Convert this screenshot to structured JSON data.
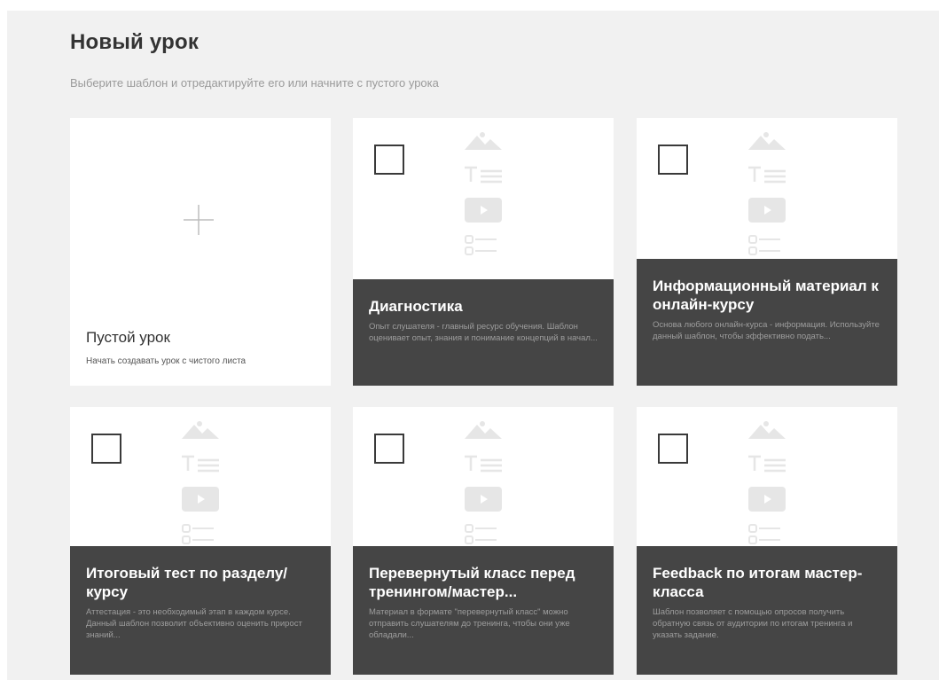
{
  "header": {
    "title": "Новый урок",
    "subtitle": "Выберите шаблон и отредактируйте его или начните с пустого урока"
  },
  "empty_card": {
    "title": "Пустой урок",
    "description": "Начать создавать урок с чистого листа",
    "icon": "plus-icon"
  },
  "templates": [
    {
      "title": "Диагностика",
      "description": "Опыт слушателя - главный ресурс обучения. Шаблон оценивает опыт, знания и понимание концепций в начал..."
    },
    {
      "title": "Информационный материал к онлайн-курсу",
      "description": "Основа любого онлайн-курса - информация. Используйте данный шаблон, чтобы эффективно подать..."
    },
    {
      "title": "Итоговый тест по разделу/ курсу",
      "description": "Аттестация - это необходимый этап в каждом курсе. Данный шаблон позволит объективно оценить прирост знаний..."
    },
    {
      "title": "Перевернутый класс перед тренингом/мастер...",
      "description": "Материал в формате \"перевернутый класс\" можно отправить слушателям до тренинга, чтобы они уже обладали..."
    },
    {
      "title": "Feedback по итогам мастер-класса",
      "description": "Шаблон позволяет с помощью опросов получить обратную связь от аудитории по итогам тренинга и указать задание."
    }
  ],
  "colors": {
    "background": "#f1f1f1",
    "card": "#ffffff",
    "band": "#454545",
    "band_desc": "#9d9d9d",
    "placeholder": "#e6e6e6"
  },
  "placeholder_icons": [
    "image-icon",
    "text-icon",
    "video-icon",
    "checklist-icon"
  ]
}
